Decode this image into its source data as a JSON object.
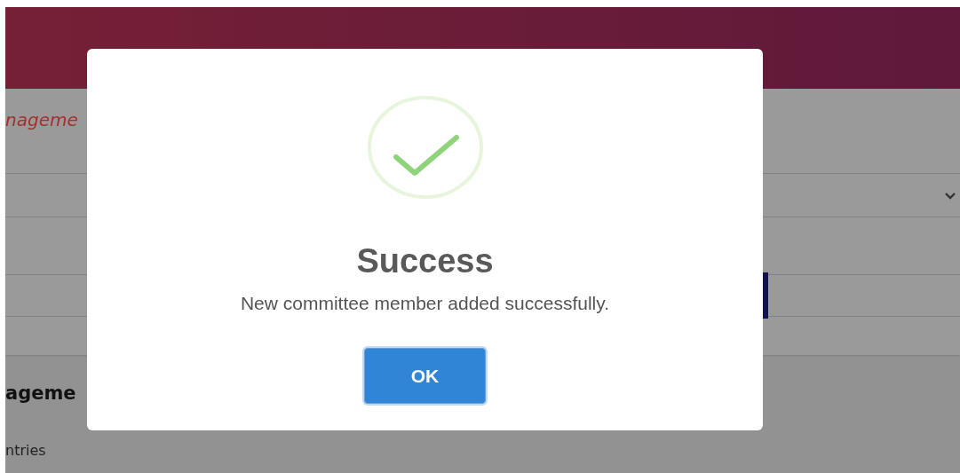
{
  "background": {
    "section_title": "nageme",
    "list_title": "ageme",
    "entries_label": "ntries"
  },
  "dialog": {
    "kind": "success",
    "title": "Success",
    "message": "New committee member added successfully.",
    "button": "OK"
  }
}
